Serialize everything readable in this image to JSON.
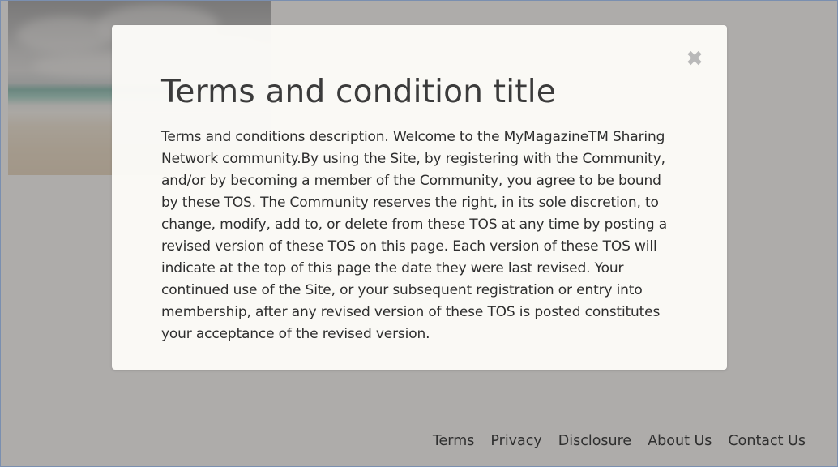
{
  "background": {
    "image_alt": "beach-photo"
  },
  "modal": {
    "close_icon": "close-icon",
    "close_glyph": "✖",
    "title": "Terms and condition title",
    "body": "Terms and conditions description. Welcome to the MyMagazineTM Sharing Network community.By using the Site, by registering with the Community, and/or by becoming a member of the Community, you agree to be bound by these TOS. The Community reserves the right, in its sole discretion, to change, modify, add to, or delete from these TOS at any time by posting a revised version of these TOS on this page. Each version of these TOS will indicate at the top of this page the date they were last revised. Your continued use of the Site, or your subsequent registration or entry into membership, after any revised version of these TOS is posted constitutes your acceptance of the revised version."
  },
  "footer": {
    "links": [
      {
        "label": "Terms"
      },
      {
        "label": "Privacy"
      },
      {
        "label": "Disclosure"
      },
      {
        "label": "About Us"
      },
      {
        "label": "Contact Us"
      }
    ]
  },
  "colors": {
    "overlay": "#878582",
    "modal_bg": "#fcfbf8",
    "text": "#2e2e2e",
    "close_icon": "#b9b9b9",
    "window_border": "#7a8fb0"
  }
}
